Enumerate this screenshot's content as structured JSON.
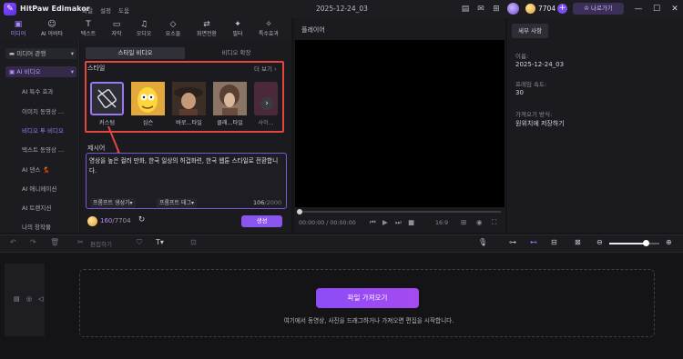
{
  "app": {
    "title": "HitPaw Edimakor",
    "menus": [
      "파일",
      "설정",
      "도움"
    ],
    "project_title": "2025-12-24_03",
    "credits": "7704",
    "upgrade_label": "나로가기"
  },
  "tools": [
    {
      "label": "미디어",
      "icon": "▣"
    },
    {
      "label": "AI 아바타",
      "icon": "☺"
    },
    {
      "label": "텍스트",
      "icon": "T"
    },
    {
      "label": "자막",
      "icon": "▭"
    },
    {
      "label": "오디오",
      "icon": "♫"
    },
    {
      "label": "요소들",
      "icon": "◇"
    },
    {
      "label": "화면전환",
      "icon": "⇄"
    },
    {
      "label": "필터",
      "icon": "✦"
    },
    {
      "label": "특수효과",
      "icon": "✧"
    }
  ],
  "sidebar": {
    "items": [
      {
        "label": "미디어 관행",
        "caret": "▾"
      },
      {
        "label": "AI 비디오",
        "caret": "▾"
      },
      {
        "label": "AI 특수 효과"
      },
      {
        "label": "이미지 동영상 ..."
      },
      {
        "label": "비디오 투 비디오"
      },
      {
        "label": "텍스트 동영상 ..."
      },
      {
        "label": "AI 댄스 💃"
      },
      {
        "label": "AI 애니메이션"
      },
      {
        "label": "AI 트랜지션"
      },
      {
        "label": "나의 창작물"
      }
    ]
  },
  "center": {
    "tab_style_video": "스타일 비디오",
    "tab_video_extend": "비디오 확장",
    "style_label": "스타일",
    "more_label": "더 보기 ›",
    "styles": [
      {
        "label": "커스텀"
      },
      {
        "label": "심슨"
      },
      {
        "label": "바로...타일"
      },
      {
        "label": "클래...타일"
      },
      {
        "label": "사이..."
      }
    ],
    "prompt_label": "제시어",
    "prompt_text": "영상을 높은 컬러 만화, 한국 일상의 허겁화련, 한국 웹툰 스타일로 전환합니다.",
    "prompt_gen_btn": "프롬프트 생성기▾",
    "prompt_tag_btn": "프롬프트 태그▾",
    "char_count": "106",
    "char_max": "/2000",
    "cost_used": "160",
    "cost_total": "/7704",
    "generate_label": "생성"
  },
  "player": {
    "title": "플레이어",
    "time_current": "00:00:00",
    "time_total": "/ 00:00:00",
    "aspect": "16:9"
  },
  "properties": {
    "tab": "세부 사항",
    "name_label": "이름:",
    "name_value": "2025-12-24_03",
    "fps_label": "프레임 속도:",
    "fps_value": "30",
    "import_mode_label": "가져오기 방식:",
    "import_mode_value": "원위치에 저장하기"
  },
  "timeline_toolbar": {
    "edit_label": "편집하기"
  },
  "timeline": {
    "import_button": "파일 가져오기",
    "hint": "여기에서 동영상, 사진을 드래그하거나 가져오면 편집을 시작합니다."
  }
}
